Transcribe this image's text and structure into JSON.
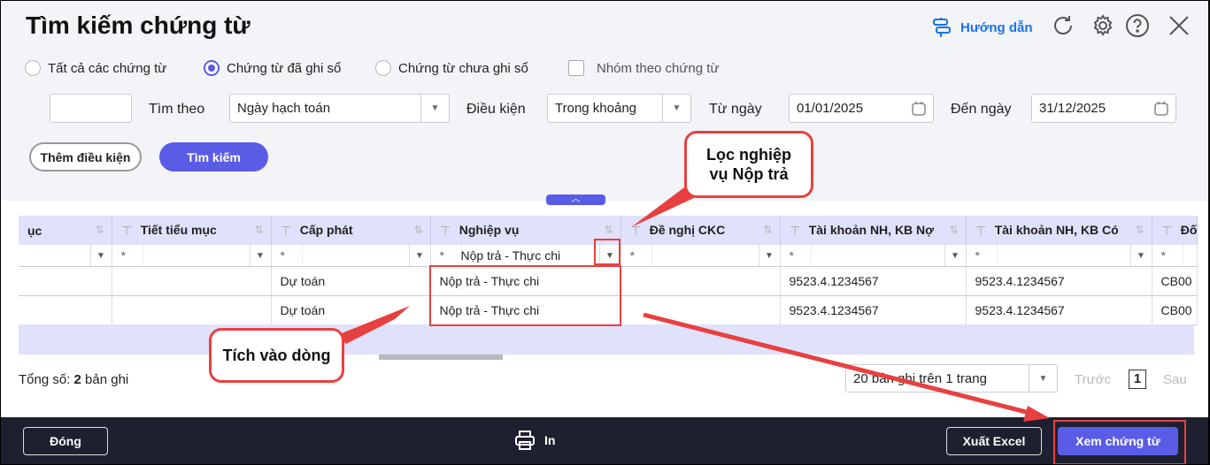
{
  "header": {
    "title": "Tìm kiếm chứng từ",
    "guide_label": "Hướng dẫn"
  },
  "filters": {
    "radios": [
      {
        "label": "Tất cả các chứng từ",
        "checked": false
      },
      {
        "label": "Chứng từ đã ghi sổ",
        "checked": true
      },
      {
        "label": "Chứng từ chưa ghi sổ",
        "checked": false
      }
    ],
    "group_checkbox": {
      "label": "Nhóm theo chứng từ",
      "checked": false
    },
    "search_by_label": "Tìm theo",
    "search_by_value": "Ngày hạch toán",
    "condition_label": "Điều kiện",
    "condition_value": "Trong khoảng",
    "from_label": "Từ ngày",
    "from_value": "01/01/2025",
    "to_label": "Đến ngày",
    "to_value": "31/12/2025",
    "add_condition": "Thêm điều kiện",
    "search": "Tìm kiếm"
  },
  "table": {
    "columns": [
      "ục",
      "Tiết tiểu mục",
      "Cấp phát",
      "Nghiệp vụ",
      "Đề nghị CKC",
      "Tài khoản NH, KB Nợ",
      "Tài khoản NH, KB Có",
      "Đố"
    ],
    "filter_star": "*",
    "filter_nghiep_vu": "Nộp trả - Thực chi",
    "rows": [
      [
        "",
        "",
        "Dự toán",
        "Nộp trả - Thực chi",
        "",
        "9523.4.1234567",
        "9523.4.1234567",
        "CB00"
      ],
      [
        "",
        "",
        "Dự toán",
        "Nộp trả - Thực chi",
        "",
        "9523.4.1234567",
        "9523.4.1234567",
        "CB00"
      ]
    ]
  },
  "pager": {
    "total_prefix": "Tổng số: ",
    "total_count": "2",
    "total_suffix": " bản ghi",
    "page_size": "20 bản ghi trên 1 trang",
    "prev": "Trước",
    "page": "1",
    "next": "Sau"
  },
  "footer": {
    "close": "Đóng",
    "print": "In",
    "export": "Xuất Excel",
    "view": "Xem chứng từ"
  },
  "annotations": {
    "filter_note": "Lọc nghiệp vụ Nộp trả",
    "row_note": "Tích vào dòng"
  },
  "colors": {
    "accent": "#5b5ce6",
    "link": "#1a73e8",
    "annotation": "#e84040",
    "footer": "#1e2030"
  }
}
